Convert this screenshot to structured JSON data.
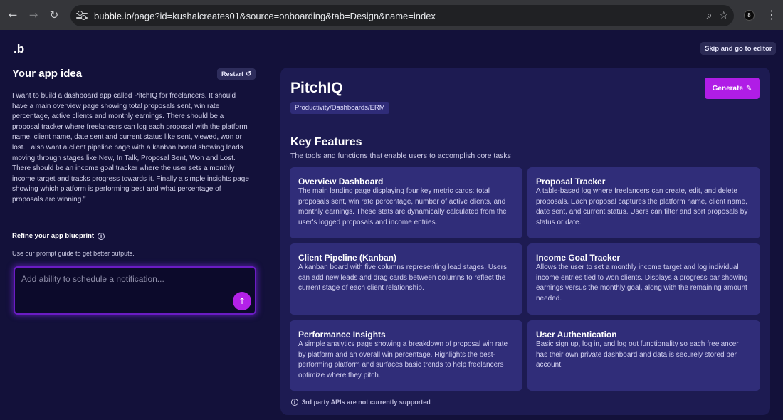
{
  "browser": {
    "back_icon": "←",
    "forward_icon": "→",
    "reload_icon": "↻",
    "url_domain": "bubble.io",
    "url_path": "/page?id=kushalcreates01&source=onboarding&tab=Design&name=index",
    "zoom_icon": "⌕",
    "star_icon": "☆",
    "profile_initial": "8",
    "menu_icon": "⋮"
  },
  "app": {
    "logo": ".b",
    "skip_label": "Skip and go to editor"
  },
  "left": {
    "title": "Your app idea",
    "restart_label": "Restart",
    "restart_icon": "↺",
    "idea_text": "I want to build a dashboard app called PitchIQ for freelancers. It should have a main overview page showing total proposals sent, win rate percentage, active clients and monthly earnings. There should be a proposal tracker where freelancers can log each proposal with the platform name, client name, date sent and current status like sent, viewed, won or lost. I also want a client pipeline page with a kanban board showing leads moving through stages like New, In Talk, Proposal Sent, Won and Lost. There should be an income goal tracker where the user sets a monthly income target and tracks progress towards it. Finally a simple insights page showing which platform is performing best and what percentage of proposals are winning.\"",
    "refine_title": "Refine your app blueprint",
    "info_icon": "i",
    "refine_sub": "Use our prompt guide to get better outputs.",
    "prompt_placeholder": "Add ability to schedule a notification...",
    "send_icon": "↑"
  },
  "panel": {
    "app_name": "PitchIQ",
    "category": "Productivity/Dashboards/ERM",
    "generate_label": "Generate",
    "generate_icon": "✎",
    "features_title": "Key Features",
    "features_sub": "The tools and functions that enable users to accomplish core tasks",
    "features": [
      {
        "title": "Overview Dashboard",
        "description": "The main landing page displaying four key metric cards: total proposals sent, win rate percentage, number of active clients, and monthly earnings. These stats are dynamically calculated from the user's logged proposals and income entries."
      },
      {
        "title": "Proposal Tracker",
        "description": "A table-based log where freelancers can create, edit, and delete proposals. Each proposal captures the platform name, client name, date sent, and current status. Users can filter and sort proposals by status or date."
      },
      {
        "title": "Client Pipeline (Kanban)",
        "description": "A kanban board with five columns representing lead stages. Users can add new leads and drag cards between columns to reflect the current stage of each client relationship."
      },
      {
        "title": "Income Goal Tracker",
        "description": "Allows the user to set a monthly income target and log individual income entries tied to won clients. Displays a progress bar showing earnings versus the monthly goal, along with the remaining amount needed."
      },
      {
        "title": "Performance Insights",
        "description": "A simple analytics page showing a breakdown of proposal win rate by platform and an overall win percentage. Highlights the best-performing platform and surfaces basic trends to help freelancers optimize where they pitch."
      },
      {
        "title": "User Authentication",
        "description": "Basic sign up, log in, and log out functionality so each freelancer has their own private dashboard and data is securely stored per account."
      }
    ],
    "footnote_icon": "i",
    "footnote": "3rd party APIs are not currently supported"
  }
}
